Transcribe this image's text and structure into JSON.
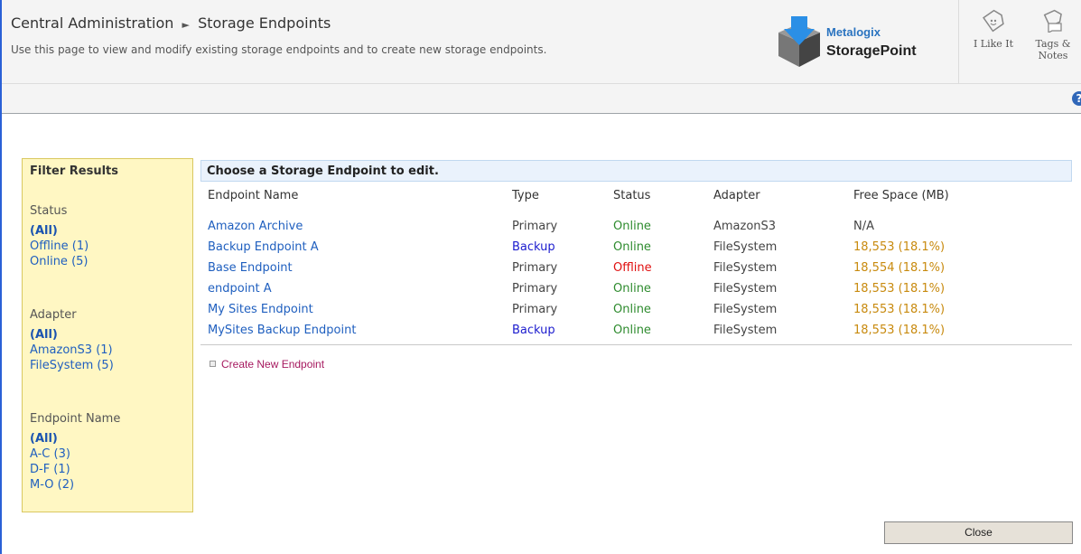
{
  "header": {
    "breadcrumb_root": "Central Administration",
    "breadcrumb_current": "Storage Endpoints",
    "subtitle": "Use this page to view and modify existing storage endpoints and to create new storage endpoints.",
    "logo_line1": "Metalogix",
    "logo_line2": "StoragePoint",
    "like_label": "I Like It",
    "tags_label_1": "Tags &",
    "tags_label_2": "Notes"
  },
  "filter": {
    "title": "Filter Results",
    "groups": [
      {
        "title": "Status",
        "items": [
          "(All)",
          "Offline (1)",
          "Online (5)"
        ]
      },
      {
        "title": "Adapter",
        "items": [
          "(All)",
          "AmazonS3 (1)",
          "FileSystem (5)"
        ]
      },
      {
        "title": "Endpoint Name",
        "items": [
          "(All)",
          "A-C (3)",
          "D-F (1)",
          "M-O (2)"
        ]
      }
    ]
  },
  "main": {
    "title": "Choose a Storage Endpoint to edit.",
    "columns": [
      "Endpoint Name",
      "Type",
      "Status",
      "Adapter",
      "Free Space (MB)"
    ],
    "rows": [
      [
        "Amazon Archive",
        "Primary",
        "Online",
        "AmazonS3",
        "N/A"
      ],
      [
        "Backup Endpoint A",
        "Backup",
        "Online",
        "FileSystem",
        "18,553 (18.1%)"
      ],
      [
        "Base Endpoint",
        "Primary",
        "Offline",
        "FileSystem",
        "18,554 (18.1%)"
      ],
      [
        "endpoint A",
        "Primary",
        "Online",
        "FileSystem",
        "18,553 (18.1%)"
      ],
      [
        "My Sites Endpoint",
        "Primary",
        "Online",
        "FileSystem",
        "18,553 (18.1%)"
      ],
      [
        "MySites Backup Endpoint",
        "Backup",
        "Online",
        "FileSystem",
        "18,553 (18.1%)"
      ]
    ],
    "create_label": "Create New Endpoint"
  },
  "footer": {
    "close_label": "Close"
  },
  "colors": {
    "online": "#2e8b2e",
    "offline": "#e01010",
    "backup": "#1c1cce",
    "free_space": "#c88a0e",
    "link": "#1f5fbf"
  }
}
